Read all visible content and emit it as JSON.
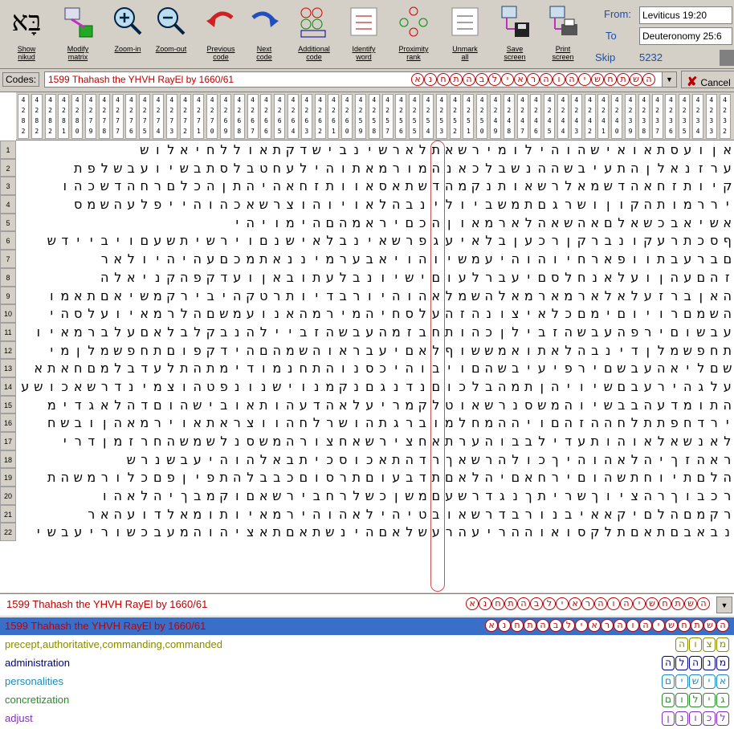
{
  "toolbar": {
    "show_nikud": "Show\nnikud",
    "modify_matrix": "Modify\nmatrix",
    "zoom_in": "Zoom-in",
    "zoom_out": "Zoom-out",
    "previous_code": "Previous\ncode",
    "next_code": "Next\ncode",
    "additional_code": "Additional\ncode",
    "identify_word": "Identify\nword",
    "proximity_rank": "Proximity\nrank",
    "unmark_all": "Unmark\nall",
    "save_screen": "Save\nscreen",
    "print_screen": "Print\nscreen",
    "logo_glyph": "בָּא"
  },
  "range": {
    "from_label": "From:",
    "from_value": "Leviticus 19:20",
    "to_label": "To",
    "to_value": "Deuteronomy 25:6",
    "skip_label": "Skip",
    "skip_value": "5232"
  },
  "codes": {
    "label": "Codes:",
    "selected": "1599 Thahash the YHVH RayEl by 1660/61",
    "hebrew": [
      "ה",
      "ש",
      "ת",
      "ח",
      "ש",
      "י",
      "ה",
      "ו",
      "ה",
      "ר",
      "א",
      "י",
      "ל",
      "ב",
      "ה",
      "ת",
      "ח",
      "נ",
      "א"
    ],
    "cancel": "Cancel"
  },
  "matrix": {
    "col_numbers": [
      "4282",
      "4282",
      "4282",
      "4281",
      "4280",
      "4279",
      "4278",
      "4277",
      "4276",
      "4275",
      "4274",
      "4273",
      "4272",
      "4271",
      "4270",
      "4269",
      "4268",
      "4267",
      "4266",
      "4265",
      "4264",
      "4263",
      "4262",
      "4261",
      "4260",
      "4259",
      "4258",
      "4257",
      "4256",
      "4255",
      "4254",
      "4253",
      "4252",
      "4251",
      "4250",
      "4249",
      "4248",
      "4247",
      "4246",
      "4245",
      "4244",
      "4243",
      "4242",
      "4241",
      "4240",
      "4239",
      "4238",
      "4237",
      "4236",
      "4235",
      "4234",
      "4233",
      "4232"
    ],
    "rows": [
      "שולאיחללואתקדשיבנישראלתאשרימוליהוהשיאואתסעוןא",
      "תפלשבעוישבתסלבטחעליהותאמרומהנאכלבשנההשביעתהןלאנזרע",
      "והכשדהחרםלכהןתהיהאחזתוואסאתשדהמקנתואשרלאמשדהאחזתויק",
      "סמשהעלפייהוהכאשרצוהויואלהבנילויבשמתםגרשוןוקהתומררי",
      "יהיומיהםהמאריםכהןואמראלהאשהאםלאשכבאישא",
      "שדייביוםעשתישריוםנשיאלבניאשרפגעיאלבןעכרןקרבנוקערתכסף",
      "ראלויהיהעםכמתאננימרעבאיוהוישמעיהוהויחראפוותבערבם",
      "הלאינקהפקדעוןאבותעלבנוישיםועלרבעיםסלחנאלעוןהעםהז",
      "ומאתםאישמקריביהקטרתוידברויהוהאלמשהלאמראמראלאלעזרבןאה",
      "יהסלעויאמרלהםשמעונאהמרימהיחסלעהזהנוציאלכםמיםויורםמשה",
      "ויאמרבלעםאלבלקבנהלייבזהשבעהמזבחתוהכןליבזהשבעהפריםושבע",
      "ימןלמשפחתםופקדיהםהמשהוארבעיםאלףוששמאותאלהבנידןלמשפחת",
      "אתאחםמלבדעלתהתמידומנחתהונסכיהוביוםהשביעיפריםשבעהאילםש",
      "עשוכאשרדנימצוהטפנונשיונמקנםגנדנםוכלבהמתןהיוישםבעריהגלע",
      "מידגאלהדםוהשיבואתוהעדהאלעירמקלטואשרנסשמהוישבבהעדמותה",
      "חשבוןהאמריואתארצווהחלרשוהתגרבומלחמההיוםהזההחלתתפחדרי",
      "ירדןמזרחהשמשלנסשמהרוצחאשריצחאתרעהובבלידעתוהואלאשנאל",
      "שרנשבעיהוהלאבתיכסוכאתהדרךאשרהלוכךיהוהאלהיךזהאר",
      "תהשמרולכםפןיפתהלבבכםוסרתםועבדתםאלהיםאחריםוהשתחויתםלה",
      "והאלהיךבמקוםאשריבחרלשכןשמםעשרדגנךתירשךויצהרךובכר",
      "ראהעודלאמותויאמריהוהאליהיטבואשרדברונביאאקיםלהםמקר",
      "ישבעירושכבעמהוהיצאתםאתשניהםאלשערהעירההואוסקלתםאתםבאבנ"
    ],
    "selected_column_hebrew": [
      "א",
      "כ",
      "ח",
      "ו",
      "ב",
      "ה",
      "א",
      "י",
      "י",
      "מ",
      "ח",
      "ו",
      "ה",
      "י",
      "ה",
      "ש",
      "צ",
      "ת",
      "ס",
      "ש",
      "ה",
      "א"
    ]
  },
  "result": {
    "title": "1599 Thahash the YHVH RayEl by 1660/61",
    "hebrew": [
      "ה",
      "ש",
      "ת",
      "ח",
      "ש",
      "י",
      "ה",
      "ו",
      "ה",
      "ר",
      "א",
      "י",
      "ל",
      "ב",
      "ה",
      "ת",
      "ח",
      "נ",
      "א"
    ]
  },
  "list": [
    {
      "label": "1599 Thahash the YHVH RayEl by 1660/61",
      "hebrew": [
        "ה",
        "ש",
        "ת",
        "ח",
        "ש",
        "י",
        "ה",
        "ו",
        "ה",
        "ר",
        "א",
        "י",
        "ל",
        "ב",
        "ה",
        "ת",
        "ח",
        "נ",
        "א"
      ],
      "color": "#c00000"
    },
    {
      "label": "precept,authoritative,commanding,commanded",
      "hebrew": [
        "מ",
        "צ",
        "ו",
        "ה"
      ],
      "color": "#8a8a00"
    },
    {
      "label": "administration",
      "hebrew": [
        "מ",
        "נ",
        "ה",
        "ל",
        "ה"
      ],
      "color": "#000080"
    },
    {
      "label": "personalities",
      "hebrew": [
        "א",
        "י",
        "ש",
        "י",
        "ם"
      ],
      "color": "#1a8ac0"
    },
    {
      "label": "concretization",
      "hebrew": [
        "ג",
        "י",
        "ל",
        "ו",
        "ם"
      ],
      "color": "#2a8a2a"
    },
    {
      "label": "adjust",
      "hebrew": [
        "ל",
        "כ",
        "ו",
        "נ",
        "ן"
      ],
      "color": "#8030c0"
    }
  ]
}
